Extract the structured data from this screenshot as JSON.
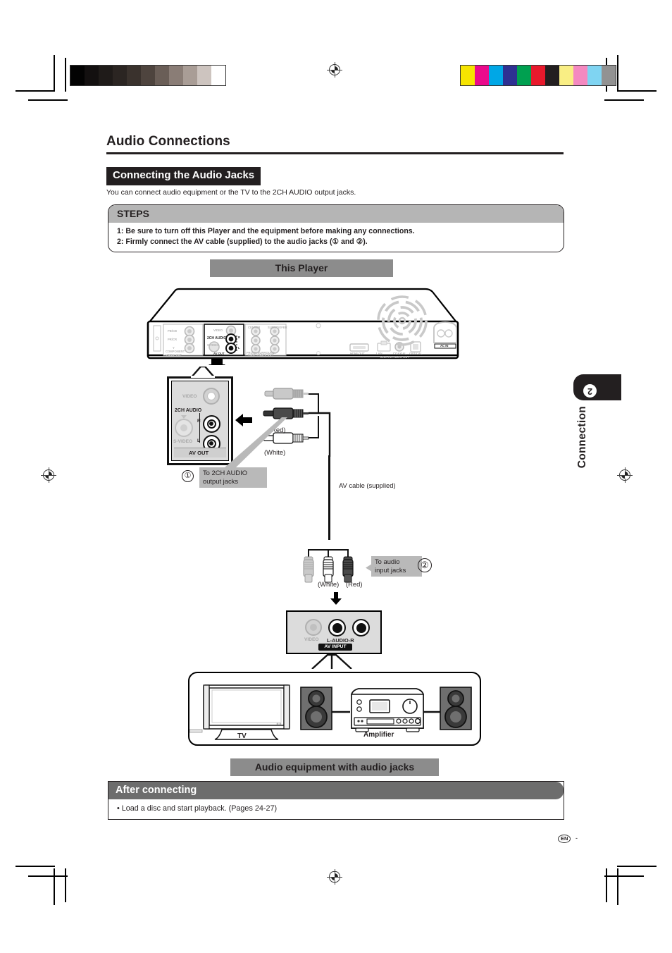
{
  "page": {
    "title": "Audio Connections",
    "section_heading": "Connecting the Audio Jacks",
    "lead": "You can connect audio equipment or the TV to the 2CH AUDIO output jacks.",
    "footer_lang": "EN",
    "footer_dash": "-"
  },
  "steps": {
    "heading": "STEPS",
    "items": [
      "1: Be sure to turn off this Player and the equipment before making any connections.",
      "2: Firmly connect the AV cable (supplied) to the audio jacks (① and ②)."
    ]
  },
  "side_tab": {
    "number": "2",
    "label": "Connection"
  },
  "diagram": {
    "player_banner": "This Player",
    "equipment_banner": "Audio equipment with audio jacks",
    "av_cable_label": "AV cable (supplied)",
    "callout_1": {
      "number": "①",
      "text_line1": "To 2CH AUDIO",
      "text_line2": "output jacks"
    },
    "callout_2": {
      "number": "②",
      "text_line1": "To audio",
      "text_line2": "input jacks"
    },
    "av_out_panel": {
      "title": "AV OUT",
      "video_label": "VIDEO",
      "audio_label": "2CH AUDIO",
      "right_label": "R",
      "left_label": "L",
      "svideo_label": "S-VIDEO"
    },
    "av_in_panel": {
      "title": "AV INPUT",
      "video_label": "VIDEO",
      "audio_label": "L-AUDIO-R"
    },
    "plug_labels": {
      "red": "(Red)",
      "white": "(White)",
      "red2": "(Red)",
      "white2": "(White)"
    },
    "devices": {
      "tv": "TV",
      "amplifier": "Amplifier"
    },
    "rear_panel_labels": {
      "component_video_out": "COMPONENT VIDEO OUT",
      "pb": "PB/CB",
      "pr": "PR/CR",
      "y": "Y",
      "video_out": "VIDEO",
      "two_ch_audio": "2CH AUDIO",
      "s_video": "S-VIDEO",
      "av_out": "AV OUT",
      "center": "CENTER",
      "subwoofer": "SUBWOOFER",
      "front_surround": "FRONT  SURROUND",
      "seven_one": "7.1CH AUDIO OUT",
      "hdmi_out": "HDMI OUT",
      "lan": "LAN",
      "coaxial": "COAXIAL",
      "optical": "OPTICAL",
      "digital_audio_out": "DIGITAL AUDIO OUT",
      "ac_in": "AC IN"
    }
  },
  "after_connecting": {
    "heading": "After connecting",
    "bullet": "• Load a disc and start playback. (Pages 24-27)"
  },
  "calibration": {
    "gray_patches": [
      "#030303",
      "#131010",
      "#1f1b19",
      "#2b2522",
      "#3a322d",
      "#4e443e",
      "#6a5e57",
      "#8a7d76",
      "#a99d96",
      "#cdc4bf",
      "#ffffff"
    ],
    "color_patches": [
      "#f6e400",
      "#ea0a8c",
      "#00a7e6",
      "#2e3192",
      "#00a050",
      "#e8192c",
      "#231f20",
      "#f9ee84",
      "#f489c0",
      "#7fd4f2",
      "#929292"
    ]
  },
  "colors": {
    "ink": "#231f20",
    "banner_gray": "#8c8c8c",
    "steps_head_gray": "#b5b5b5",
    "after_head_gray": "#6d6d6d",
    "callout_gray": "#b9b9b9",
    "panel_gray": "#dcdcdc",
    "speaker_gray": "#6f6f6f"
  }
}
